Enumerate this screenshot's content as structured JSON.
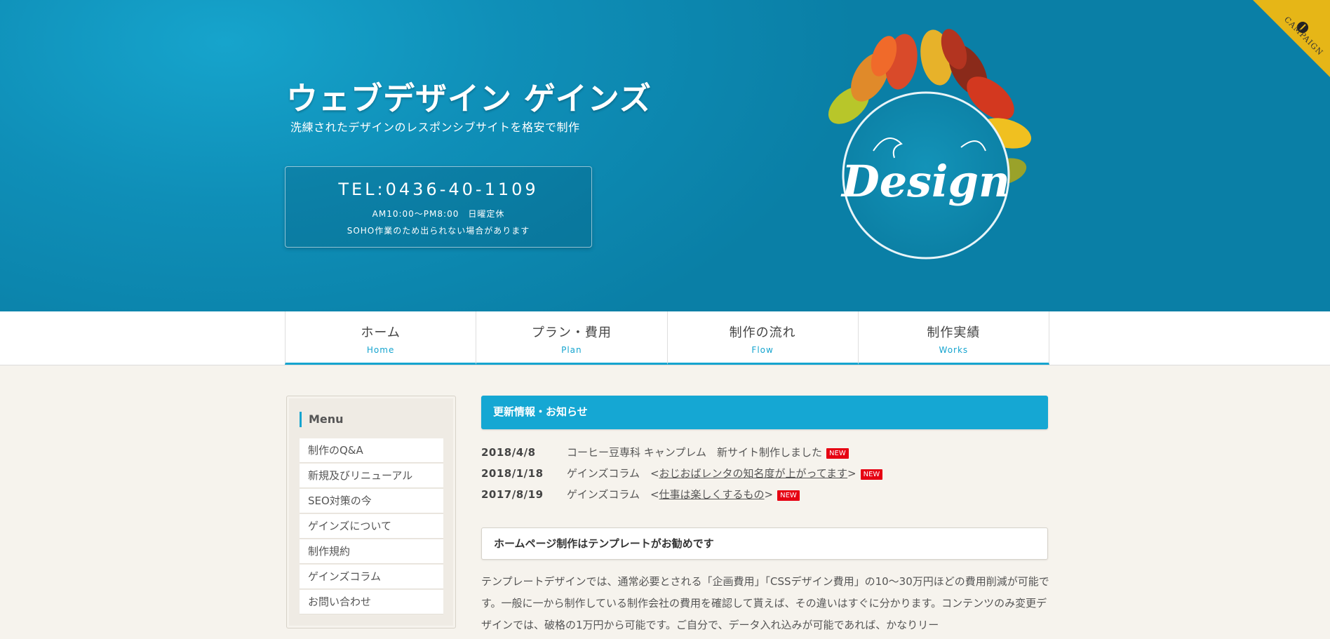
{
  "header": {
    "title": "ウェブデザイン ゲインズ",
    "subtitle": "洗練されたデザインのレスポンシブサイトを格安で制作",
    "tel": "TEL:0436-40-1109",
    "hours": "AM10:00～PM8:00　日曜定休",
    "note": "SOHO作業のため出られない場合があります",
    "deco_text": "Design",
    "campaign": "CAMPAIGN"
  },
  "nav": [
    {
      "jp": "ホーム",
      "en": "Home"
    },
    {
      "jp": "プラン・費用",
      "en": "Plan"
    },
    {
      "jp": "制作の流れ",
      "en": "Flow"
    },
    {
      "jp": "制作実績",
      "en": "Works"
    }
  ],
  "sidebar": {
    "title": "Menu",
    "items": [
      "制作のQ&A",
      "新規及びリニューアル",
      "SEO対策の今",
      "ゲインズについて",
      "制作規約",
      "ゲインズコラム",
      "お問い合わせ"
    ]
  },
  "news": {
    "title": "更新情報・お知らせ",
    "badge": "NEW",
    "items": [
      {
        "date": "2018/4/8",
        "prefix": "コーヒー豆専科 キャンプレム　新サイト制作しました",
        "link": "",
        "suffix": ""
      },
      {
        "date": "2018/1/18",
        "prefix": "ゲインズコラム　<",
        "link": "おじおばレンタの知名度が上がってます",
        "suffix": ">"
      },
      {
        "date": "2017/8/19",
        "prefix": "ゲインズコラム　<",
        "link": "仕事は楽しくするもの",
        "suffix": ">"
      }
    ]
  },
  "section": {
    "title": "ホームページ制作はテンプレートがお勧めです",
    "paragraph": "テンプレートデザインでは、通常必要とされる「企画費用」「CSSデザイン費用」の10～30万円ほどの費用削減が可能です。一般に一から制作している制作会社の費用を確認して貰えば、その違いはすぐに分かります。コンテンツのみ変更デザインでは、破格の1万円から可能です。ご自分で、データ入れ込みが可能であれば、かなりリー"
  }
}
